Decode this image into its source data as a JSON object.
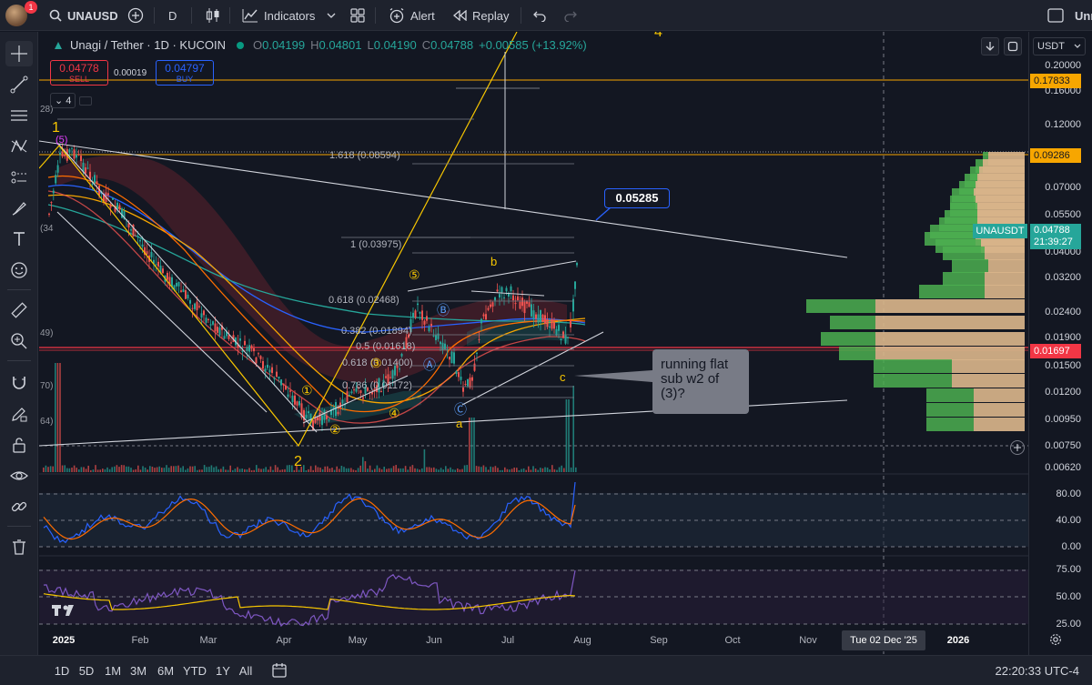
{
  "toolbar": {
    "notification_count": "1",
    "symbol": "UNAUSD",
    "interval": "D",
    "indicators_label": "Indicators",
    "alert_label": "Alert",
    "replay_label": "Replay",
    "user_label_partial": "Unn"
  },
  "legend": {
    "title": "Unagi / Tether · 1D · KUCOIN",
    "open_key": "O",
    "open": "0.04199",
    "high_key": "H",
    "high": "0.04801",
    "low_key": "L",
    "low": "0.04190",
    "close_key": "C",
    "close": "0.04788",
    "change": "+0.00585 (+13.92%)"
  },
  "order": {
    "sell_price": "0.04778",
    "sell_label": "SELL",
    "spread": "0.00019",
    "buy_price": "0.04797",
    "buy_label": "BUY"
  },
  "indicators_collapse": {
    "count": "4"
  },
  "annotations": {
    "price_callout": "0.05285",
    "note": "running flat sub w2 of (3)?",
    "wave_labels": {
      "w1": "1",
      "w2": "2",
      "w4_top": "4",
      "w5_paren": "(5)",
      "b": "b",
      "a": "a",
      "c": "c",
      "c1": "①",
      "c2": "②",
      "c3": "③",
      "c4": "④",
      "c5": "⑤",
      "cA": "Ⓐ",
      "cB": "Ⓑ",
      "cC": "Ⓒ"
    },
    "fibs": {
      "f1618": "1.618 (0.08594)",
      "f1": "1 (0.03975)",
      "f0618": "0.618 (0.02468)",
      "f0382": "0.382 (0.01894)",
      "f05": "0.5 (0.01618)",
      "f0618b": "0.618 (0.01400)",
      "f0786": "0.786 (0.01172)"
    },
    "left_cut_labels": {
      "a": "28)",
      "b": "(34",
      "c": "49)",
      "d": "70)",
      "e": "64)"
    }
  },
  "price_axis": {
    "currency": "USDT",
    "labels": [
      "0.20000",
      "0.16000",
      "0.12000",
      "0.07000",
      "0.05500",
      "0.04000",
      "0.03200",
      "0.02400",
      "0.01900",
      "0.01500",
      "0.01200",
      "0.00950",
      "0.00750",
      "0.00620",
      "80.00",
      "40.00",
      "0.00",
      "75.00",
      "50.00",
      "25.00"
    ],
    "tags": {
      "orange_top": "0.17833",
      "orange_mid": "0.09286",
      "symbol_name": "UNAUSDT",
      "last_price": "0.04788",
      "countdown": "21:39:27",
      "red_line": "0.01697"
    },
    "tag_colors": {
      "orange": "#f7a600",
      "green": "#26a69a",
      "red": "#f23645"
    }
  },
  "time_axis": {
    "labels": [
      "2025",
      "Feb",
      "Mar",
      "Apr",
      "May",
      "Jun",
      "Jul",
      "Aug",
      "Sep",
      "Oct",
      "Nov",
      "2026"
    ],
    "crosshair_date": "Tue 02 Dec '25"
  },
  "bottom_bar": {
    "ranges": [
      "1D",
      "5D",
      "1M",
      "3M",
      "6M",
      "YTD",
      "1Y",
      "All"
    ],
    "clock": "22:20:33 UTC-4"
  },
  "chart_data": {
    "type": "candlestick",
    "symbol": "UNAUSDT",
    "scale": "log",
    "y_range": [
      0.0062,
      0.2
    ],
    "monthly_closes_approx": {
      "x": [
        "2025-01",
        "2025-02",
        "2025-03",
        "2025-04",
        "2025-05",
        "2025-06",
        "2025-07",
        "2025-07-28"
      ],
      "close": [
        0.062,
        0.036,
        0.021,
        0.0105,
        0.0125,
        0.0112,
        0.025,
        0.04788
      ]
    },
    "horizontal_levels": [
      0.17833,
      0.09286,
      0.01697,
      0.0075
    ],
    "volume_profile": true,
    "oscillators": [
      {
        "name": "stoch",
        "range": [
          0,
          100
        ],
        "levels": [
          80,
          40,
          0
        ]
      },
      {
        "name": "rsi",
        "range": [
          25,
          75
        ],
        "levels": [
          75,
          50,
          25
        ]
      }
    ]
  }
}
